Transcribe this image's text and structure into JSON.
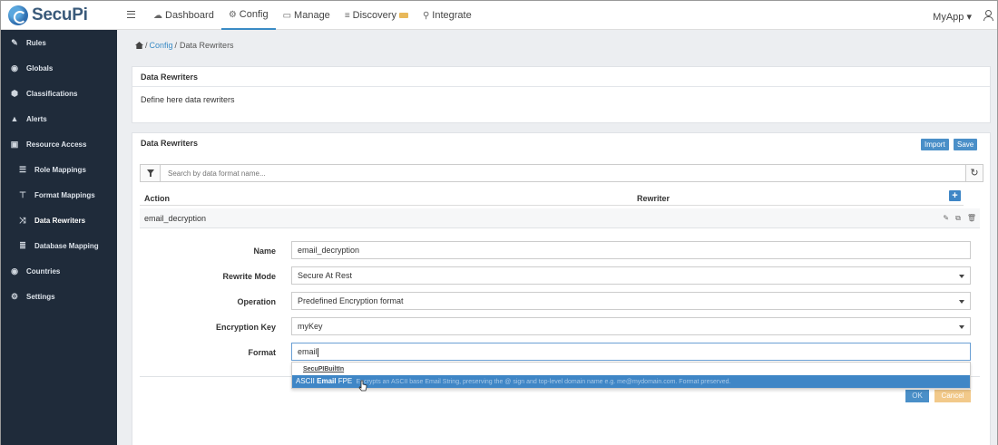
{
  "app": {
    "logo_text": "SecuPi"
  },
  "topnav": {
    "items": [
      {
        "label": "Dashboard",
        "icon": "cloud-icon"
      },
      {
        "label": "Config",
        "icon": "gear-icon"
      },
      {
        "label": "Manage",
        "icon": "monitor-icon"
      },
      {
        "label": "Discovery",
        "icon": "database-icon"
      },
      {
        "label": "Integrate",
        "icon": "location-pin-icon"
      }
    ],
    "active": "Config",
    "app_selector": "MyApp ▾"
  },
  "sidebar": {
    "items": [
      {
        "label": "Rules",
        "icon": "edit-icon"
      },
      {
        "label": "Globals",
        "icon": "globe-icon"
      },
      {
        "label": "Classifications",
        "icon": "tags-icon"
      },
      {
        "label": "Alerts",
        "icon": "warning-icon"
      },
      {
        "label": "Resource Access",
        "icon": "lock-icon"
      },
      {
        "label": "Role Mappings",
        "icon": "list-icon"
      },
      {
        "label": "Format Mappings",
        "icon": "sitemap-icon"
      },
      {
        "label": "Data Rewriters",
        "icon": "shuffle-icon"
      },
      {
        "label": "Database Mapping",
        "icon": "database-icon"
      },
      {
        "label": "Countries",
        "icon": "globe-icon"
      },
      {
        "label": "Settings",
        "icon": "gear-icon"
      }
    ],
    "active": "Data Rewriters"
  },
  "breadcrumb": {
    "config": "Config",
    "sep": "/",
    "current": "Data Rewriters"
  },
  "info_panel": {
    "title": "Data Rewriters",
    "description": "Define here data rewriters"
  },
  "list_panel": {
    "title": "Data Rewriters",
    "import_label": "Import",
    "save_label": "Save",
    "search_placeholder": "Search by data format name...",
    "columns": {
      "action": "Action",
      "rewriter": "Rewriter"
    },
    "rows": [
      {
        "action": "email_decryption",
        "rewriter": ""
      }
    ]
  },
  "form": {
    "name_label": "Name",
    "name_value": "email_decryption",
    "mode_label": "Rewrite Mode",
    "mode_value": "Secure At Rest",
    "operation_label": "Operation",
    "operation_value": "Predefined Encryption format",
    "key_label": "Encryption Key",
    "key_value": "myKey",
    "format_label": "Format",
    "format_value": "email"
  },
  "dropdown": {
    "group": "SecuPIBuiltIn",
    "option_prefix": "ASCII ",
    "option_match": "Email",
    "option_suffix": " FPE",
    "option_desc": "Encrypts an ASCII base Email String, preserving the @ sign and top-level domain name e.g. me@mydomain.com. Format preserved."
  },
  "buttons": {
    "ok": "OK",
    "cancel": "Cancel"
  }
}
